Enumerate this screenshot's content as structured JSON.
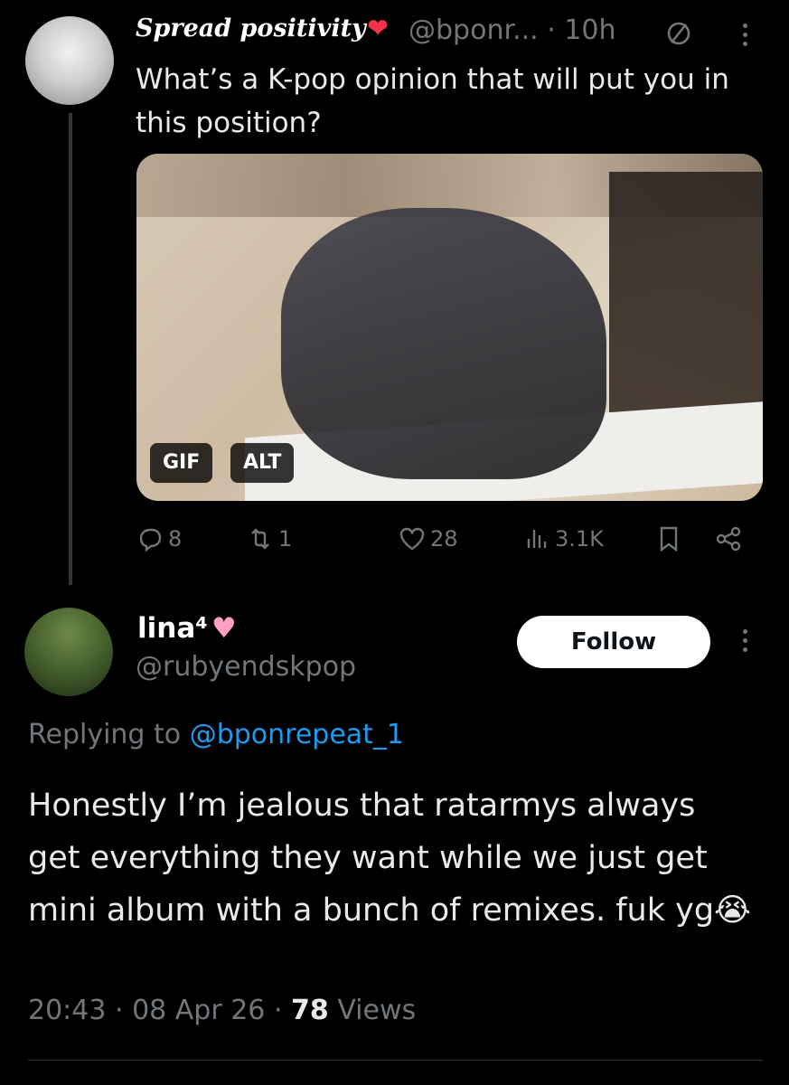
{
  "parent_tweet": {
    "display_name": "Spread positivity",
    "handle": "@bponr...",
    "time": "10h",
    "text": "What’s a K-pop opinion that will put you in this position?",
    "media": {
      "badges": {
        "gif": "GIF",
        "alt": "ALT"
      }
    },
    "stats": {
      "replies": "8",
      "reposts": "1",
      "likes": "28",
      "views": "3.1K"
    }
  },
  "reply_tweet": {
    "display_name": "lina⁴",
    "handle": "@rubyendskpop",
    "follow_label": "Follow",
    "replying_prefix": "Replying to",
    "replying_to": "@bponrepeat_1",
    "text": "Honestly I’m jealous that ratarmys always get everything they want while we just get  mini album with a bunch of remixes. fuk yg😭",
    "timestamp_time": "20:43",
    "timestamp_date": "08 Apr 26",
    "views_count": "78",
    "views_label": "Views"
  },
  "colors": {
    "background": "#000000",
    "text_primary": "#e7e9ea",
    "text_secondary": "#71767b",
    "link": "#1d9bf0",
    "heart": "#f2334a",
    "pink_heart": "#ff9fc4"
  }
}
